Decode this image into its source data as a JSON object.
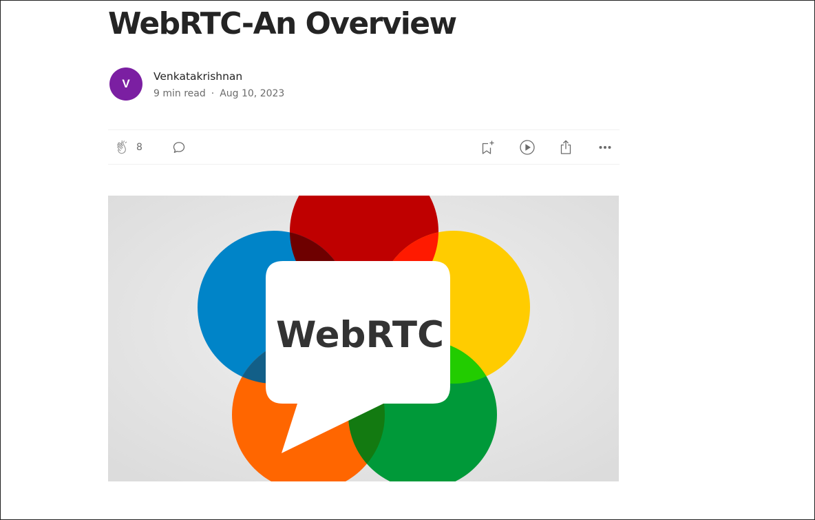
{
  "article": {
    "title": "WebRTC-An Overview",
    "author": {
      "name": "Venkatakrishnan",
      "avatar_initial": "V",
      "avatar_color": "#7b1fa2"
    },
    "read_time": "9 min read",
    "separator": "·",
    "date": "Aug 10, 2023"
  },
  "actions": {
    "clap_count": "8",
    "icons": [
      "clap-icon",
      "comment-icon",
      "bookmark-add-icon",
      "play-listen-icon",
      "share-icon",
      "more-options-icon"
    ]
  },
  "hero_image": {
    "logo_text": "WebRTC",
    "colors": {
      "red": "#bf0000",
      "yellow": "#ffcc00",
      "blue": "#0084c8",
      "orange": "#ff6600",
      "green": "#009939",
      "background": "#e6e6e6",
      "bubble": "#ffffff",
      "text": "#333333"
    }
  }
}
